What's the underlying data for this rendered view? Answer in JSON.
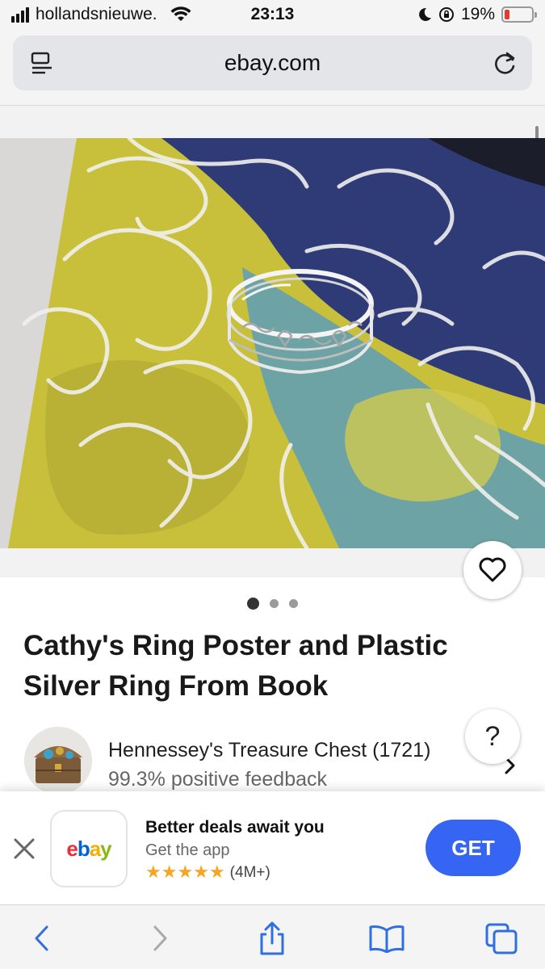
{
  "status_bar": {
    "carrier": "hollandsnieuwe.",
    "time": "23:13",
    "battery_percent": "19%",
    "battery_level": 0.19,
    "icons": [
      "signal-icon",
      "wifi-icon",
      "moon-icon",
      "orientation-lock-icon",
      "battery-icon"
    ]
  },
  "browser": {
    "address": "ebay.com",
    "icons": [
      "reader-icon",
      "reload-icon"
    ]
  },
  "listing": {
    "title": "Cathy's Ring Poster and Plastic Silver Ring From Book",
    "image_count": 3,
    "active_image": 1,
    "seller": {
      "name": "Hennessey's Treasure Chest (1721)",
      "feedback": "99.3% positive feedback"
    },
    "help_label": "?"
  },
  "app_banner": {
    "logo_letters": [
      "e",
      "b",
      "a",
      "y"
    ],
    "title": "Better deals await you",
    "subtitle": "Get the app",
    "stars": 5,
    "rating_count": "(4M+)",
    "get_label": "GET"
  },
  "colors": {
    "accent": "#3665f3",
    "star": "#f5a623",
    "battery_low": "#e53935"
  },
  "toolbar": {
    "icons": [
      "back-icon",
      "forward-icon",
      "share-icon",
      "bookmarks-icon",
      "tabs-icon"
    ]
  }
}
